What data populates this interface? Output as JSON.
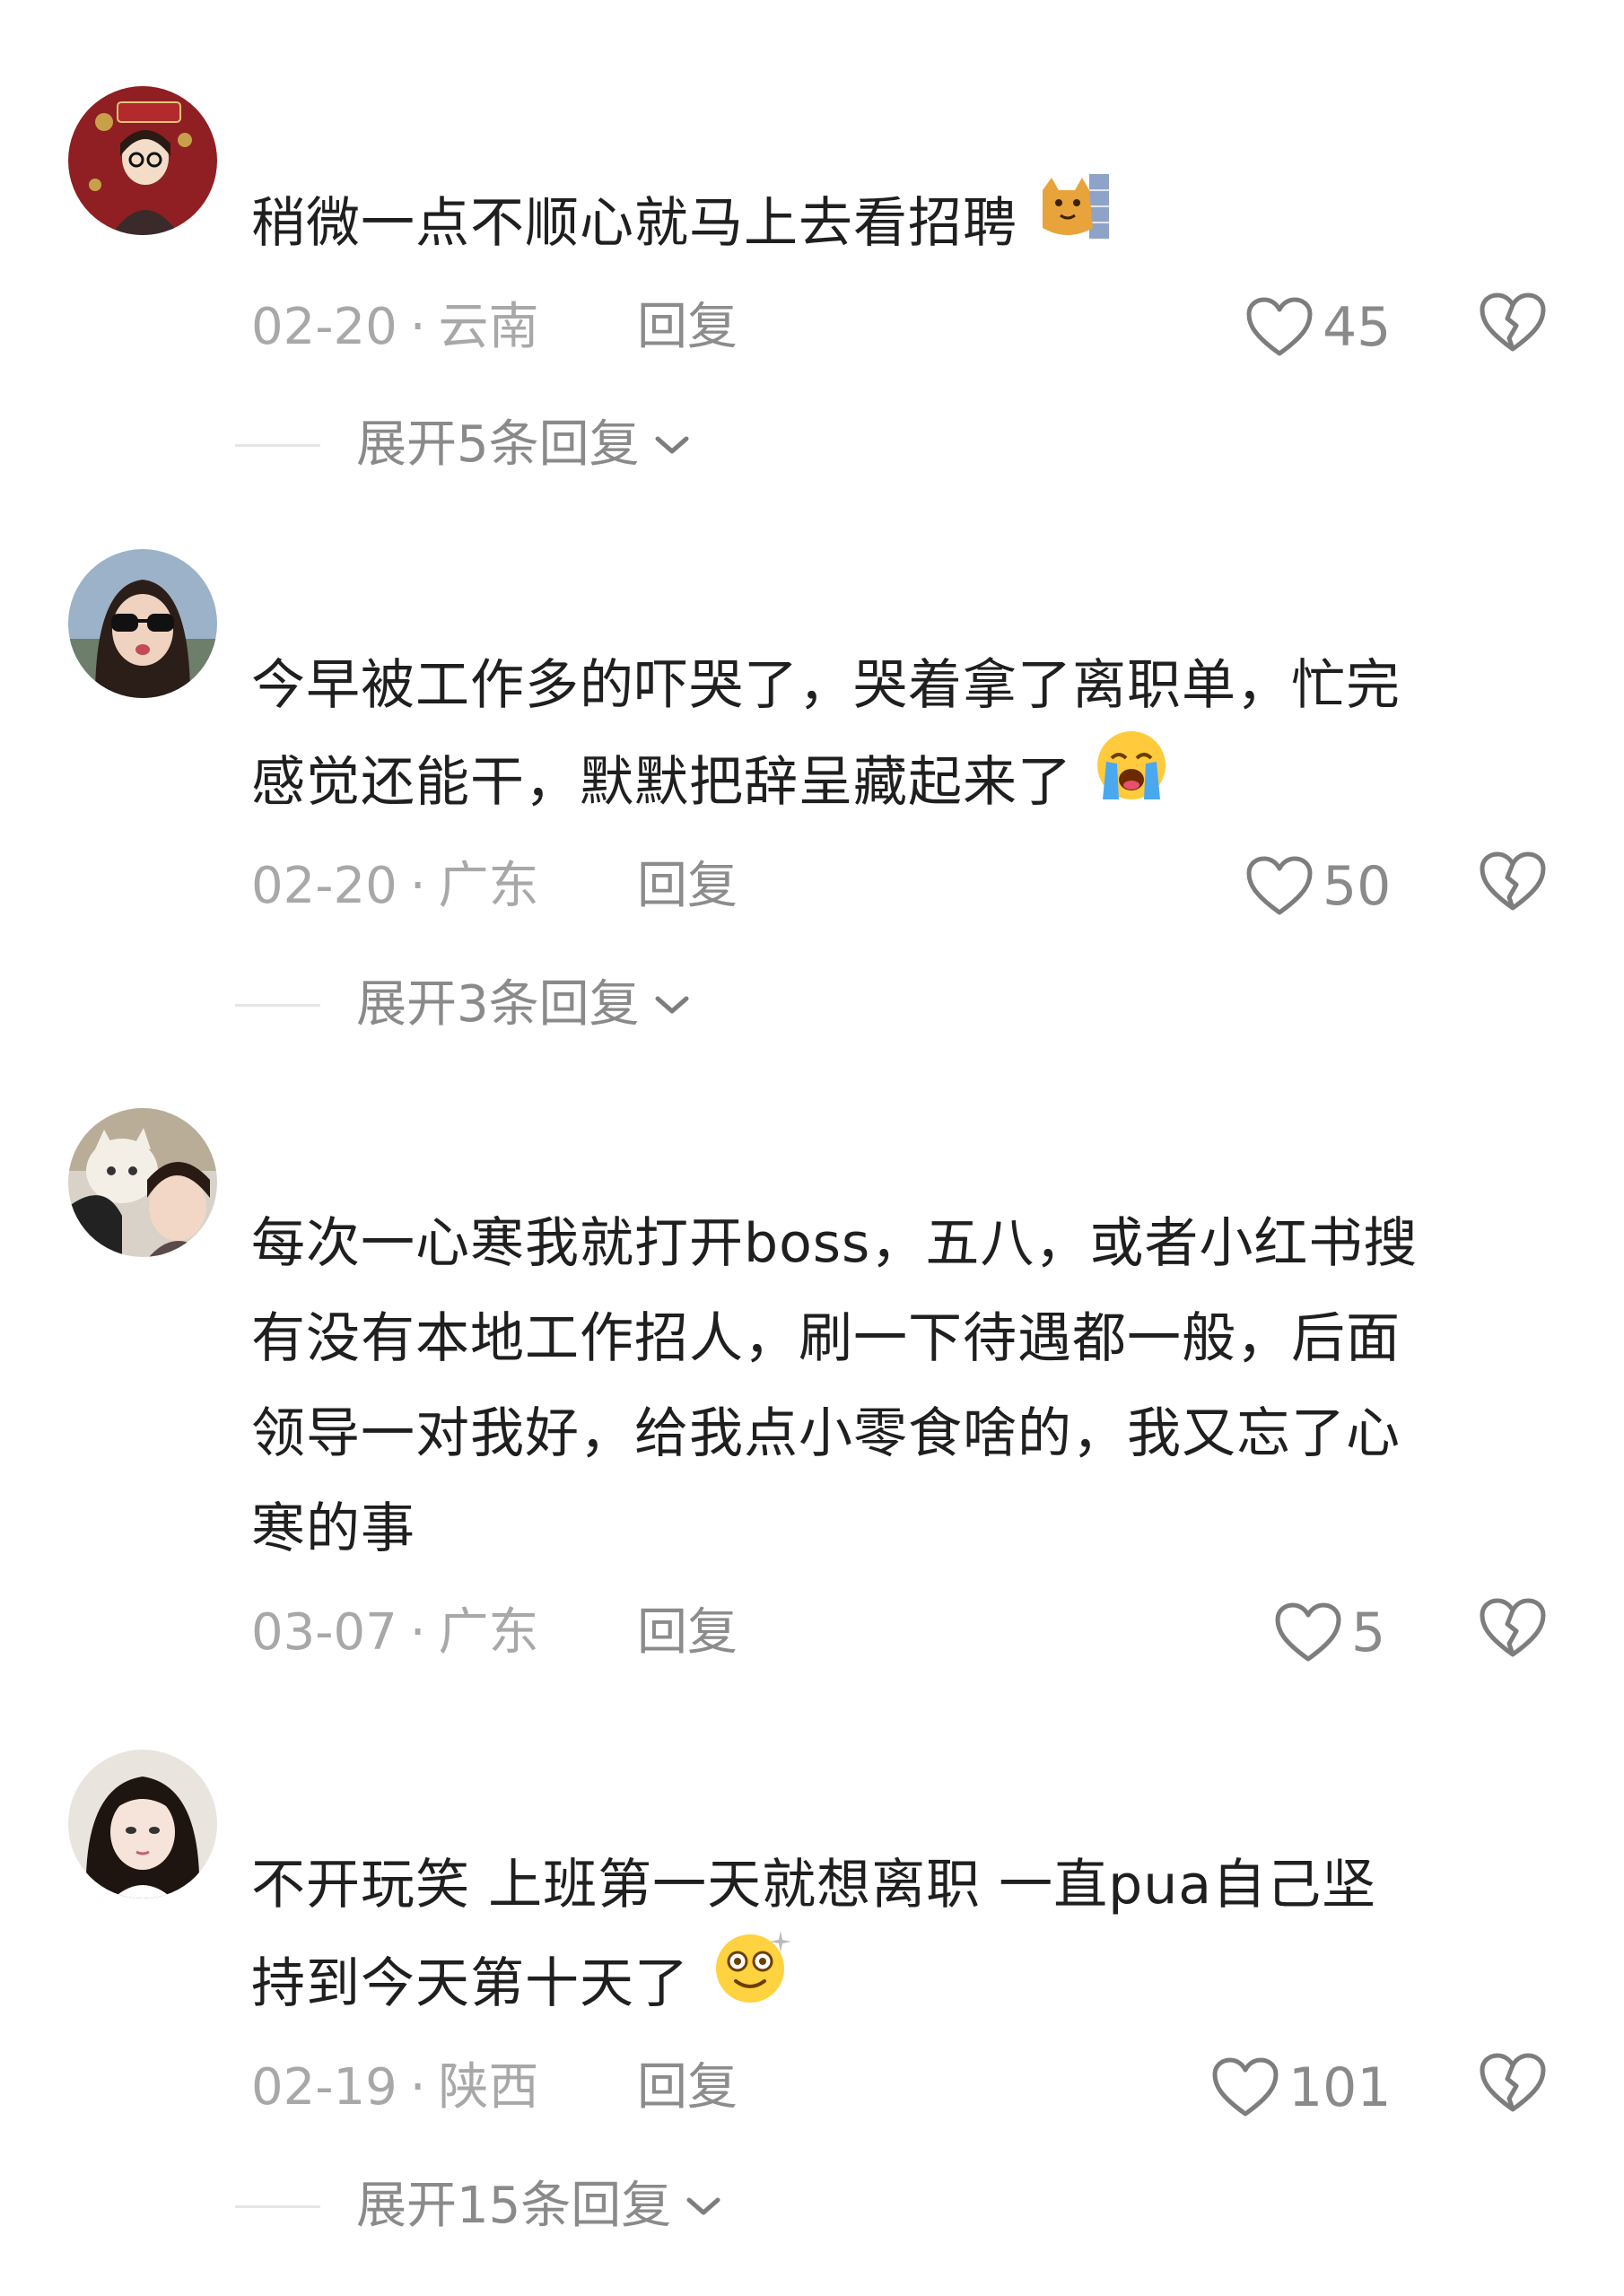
{
  "comments": [
    {
      "lines": [
        "稍微一点不顺心就马上去看招聘"
      ],
      "emoji": "cat-face-emoji",
      "date": "02-20",
      "location": "云南",
      "reply_label": "回复",
      "likes": "45",
      "expand_label": "展开5条回复"
    },
    {
      "lines": [
        "今早被工作多的吓哭了，哭着拿了离职单，忙完",
        "感觉还能干，默默把辞呈藏起来了"
      ],
      "emoji": "loudly-crying-face-emoji",
      "date": "02-20",
      "location": "广东",
      "reply_label": "回复",
      "likes": "50",
      "expand_label": "展开3条回复"
    },
    {
      "lines": [
        "每次一心寒我就打开boss，五八，或者小红书搜",
        "有没有本地工作招人，刷一下待遇都一般，后面",
        "领导一对我好，给我点小零食啥的，我又忘了心",
        "寒的事"
      ],
      "date": "03-07",
      "location": "广东",
      "reply_label": "回复",
      "likes": "5"
    },
    {
      "lines": [
        "不开玩笑  上班第一天就想离职   一直pua自己坚",
        "持到今天第十天了"
      ],
      "emoji": "dizzy-face-emoji",
      "date": "02-19",
      "location": "陕西",
      "reply_label": "回复",
      "likes": "101",
      "expand_label": "展开15条回复"
    }
  ],
  "separator": "·",
  "colors": {
    "text": "#1f1f1f",
    "meta": "#a8a8a8",
    "action": "#8a8a8a",
    "background": "#ffffff"
  }
}
